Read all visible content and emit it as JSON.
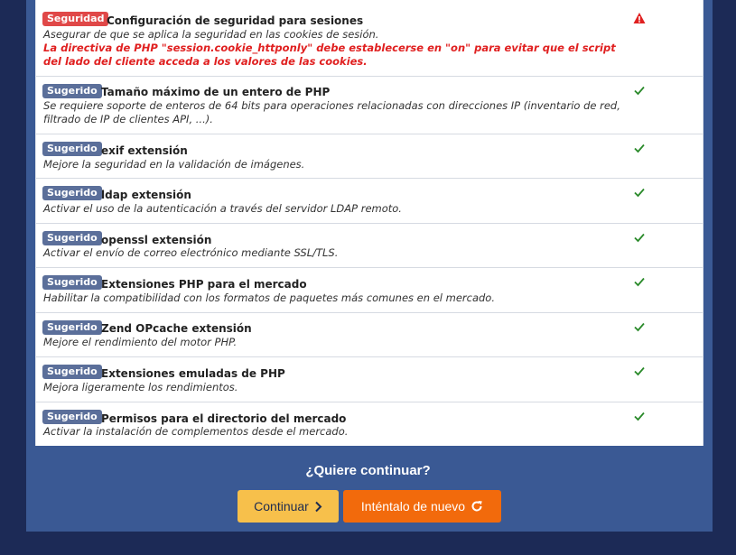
{
  "rows": [
    {
      "badge": "Seguridad",
      "title": "Configuración de seguridad para sesiones",
      "description": "Asegurar de que se aplica la seguridad en las cookies de sesión.",
      "warning": "La directiva de PHP \"session.cookie_httponly\" debe establecerse en \"on\" para evitar que el script del lado del cliente acceda a los valores de las cookies.",
      "status_icon": "warning-icon",
      "status_color": "#e02020"
    },
    {
      "badge": "Sugerido",
      "title": "Tamaño máximo de un entero de PHP",
      "description": "Se requiere soporte de enteros de 64 bits para operaciones relacionadas con direcciones IP (inventario de red, filtrado de IP de clientes API, ...).",
      "status_icon": "check-icon",
      "status_color": "#2a8a2a"
    },
    {
      "badge": "Sugerido",
      "title": "exif extensión",
      "description": "Mejore la seguridad en la validación de imágenes.",
      "status_icon": "check-icon",
      "status_color": "#2a8a2a"
    },
    {
      "badge": "Sugerido",
      "title": "ldap extensión",
      "description": "Activar el uso de la autenticación a través del servidor LDAP remoto.",
      "status_icon": "check-icon",
      "status_color": "#2a8a2a"
    },
    {
      "badge": "Sugerido",
      "title": "openssl extensión",
      "description": "Activar el envío de correo electrónico mediante SSL/TLS.",
      "status_icon": "check-icon",
      "status_color": "#2a8a2a"
    },
    {
      "badge": "Sugerido",
      "title": "Extensiones PHP para el mercado",
      "description": "Habilitar la compatibilidad con los formatos de paquetes más comunes en el mercado.",
      "status_icon": "check-icon",
      "status_color": "#2a8a2a"
    },
    {
      "badge": "Sugerido",
      "title": "Zend OPcache extensión",
      "description": "Mejore el rendimiento del motor PHP.",
      "status_icon": "check-icon",
      "status_color": "#2a8a2a"
    },
    {
      "badge": "Sugerido",
      "title": "Extensiones emuladas de PHP",
      "description": "Mejora ligeramente los rendimientos.",
      "status_icon": "check-icon",
      "status_color": "#2a8a2a"
    },
    {
      "badge": "Sugerido",
      "title": "Permisos para el directorio del mercado",
      "description": "Activar la instalación de complementos desde el mercado.",
      "status_icon": "check-icon",
      "status_color": "#2a8a2a"
    }
  ],
  "footer": {
    "question": "¿Quiere continuar?",
    "continue_label": "Continuar",
    "continue_icon": "chevron-right-icon",
    "retry_label": "Inténtalo de nuevo",
    "retry_icon": "refresh-icon"
  },
  "colors": {
    "background": "#1c2a56",
    "panel": "#3a5994",
    "continue_button": "#f7c04b",
    "retry_button": "#f26a0c",
    "badge_seguridad": "#e04848",
    "badge_sugerido": "#5b6f9a"
  }
}
